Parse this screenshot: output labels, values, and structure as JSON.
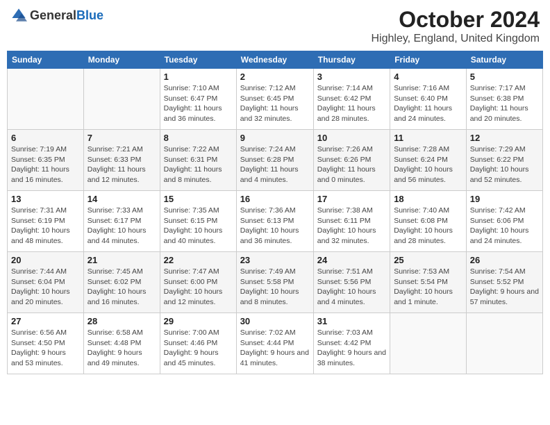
{
  "logo": {
    "text_general": "General",
    "text_blue": "Blue"
  },
  "header": {
    "month_title": "October 2024",
    "location": "Highley, England, United Kingdom"
  },
  "weekdays": [
    "Sunday",
    "Monday",
    "Tuesday",
    "Wednesday",
    "Thursday",
    "Friday",
    "Saturday"
  ],
  "weeks": [
    [
      {
        "day": "",
        "info": ""
      },
      {
        "day": "",
        "info": ""
      },
      {
        "day": "1",
        "info": "Sunrise: 7:10 AM\nSunset: 6:47 PM\nDaylight: 11 hours and 36 minutes."
      },
      {
        "day": "2",
        "info": "Sunrise: 7:12 AM\nSunset: 6:45 PM\nDaylight: 11 hours and 32 minutes."
      },
      {
        "day": "3",
        "info": "Sunrise: 7:14 AM\nSunset: 6:42 PM\nDaylight: 11 hours and 28 minutes."
      },
      {
        "day": "4",
        "info": "Sunrise: 7:16 AM\nSunset: 6:40 PM\nDaylight: 11 hours and 24 minutes."
      },
      {
        "day": "5",
        "info": "Sunrise: 7:17 AM\nSunset: 6:38 PM\nDaylight: 11 hours and 20 minutes."
      }
    ],
    [
      {
        "day": "6",
        "info": "Sunrise: 7:19 AM\nSunset: 6:35 PM\nDaylight: 11 hours and 16 minutes."
      },
      {
        "day": "7",
        "info": "Sunrise: 7:21 AM\nSunset: 6:33 PM\nDaylight: 11 hours and 12 minutes."
      },
      {
        "day": "8",
        "info": "Sunrise: 7:22 AM\nSunset: 6:31 PM\nDaylight: 11 hours and 8 minutes."
      },
      {
        "day": "9",
        "info": "Sunrise: 7:24 AM\nSunset: 6:28 PM\nDaylight: 11 hours and 4 minutes."
      },
      {
        "day": "10",
        "info": "Sunrise: 7:26 AM\nSunset: 6:26 PM\nDaylight: 11 hours and 0 minutes."
      },
      {
        "day": "11",
        "info": "Sunrise: 7:28 AM\nSunset: 6:24 PM\nDaylight: 10 hours and 56 minutes."
      },
      {
        "day": "12",
        "info": "Sunrise: 7:29 AM\nSunset: 6:22 PM\nDaylight: 10 hours and 52 minutes."
      }
    ],
    [
      {
        "day": "13",
        "info": "Sunrise: 7:31 AM\nSunset: 6:19 PM\nDaylight: 10 hours and 48 minutes."
      },
      {
        "day": "14",
        "info": "Sunrise: 7:33 AM\nSunset: 6:17 PM\nDaylight: 10 hours and 44 minutes."
      },
      {
        "day": "15",
        "info": "Sunrise: 7:35 AM\nSunset: 6:15 PM\nDaylight: 10 hours and 40 minutes."
      },
      {
        "day": "16",
        "info": "Sunrise: 7:36 AM\nSunset: 6:13 PM\nDaylight: 10 hours and 36 minutes."
      },
      {
        "day": "17",
        "info": "Sunrise: 7:38 AM\nSunset: 6:11 PM\nDaylight: 10 hours and 32 minutes."
      },
      {
        "day": "18",
        "info": "Sunrise: 7:40 AM\nSunset: 6:08 PM\nDaylight: 10 hours and 28 minutes."
      },
      {
        "day": "19",
        "info": "Sunrise: 7:42 AM\nSunset: 6:06 PM\nDaylight: 10 hours and 24 minutes."
      }
    ],
    [
      {
        "day": "20",
        "info": "Sunrise: 7:44 AM\nSunset: 6:04 PM\nDaylight: 10 hours and 20 minutes."
      },
      {
        "day": "21",
        "info": "Sunrise: 7:45 AM\nSunset: 6:02 PM\nDaylight: 10 hours and 16 minutes."
      },
      {
        "day": "22",
        "info": "Sunrise: 7:47 AM\nSunset: 6:00 PM\nDaylight: 10 hours and 12 minutes."
      },
      {
        "day": "23",
        "info": "Sunrise: 7:49 AM\nSunset: 5:58 PM\nDaylight: 10 hours and 8 minutes."
      },
      {
        "day": "24",
        "info": "Sunrise: 7:51 AM\nSunset: 5:56 PM\nDaylight: 10 hours and 4 minutes."
      },
      {
        "day": "25",
        "info": "Sunrise: 7:53 AM\nSunset: 5:54 PM\nDaylight: 10 hours and 1 minute."
      },
      {
        "day": "26",
        "info": "Sunrise: 7:54 AM\nSunset: 5:52 PM\nDaylight: 9 hours and 57 minutes."
      }
    ],
    [
      {
        "day": "27",
        "info": "Sunrise: 6:56 AM\nSunset: 4:50 PM\nDaylight: 9 hours and 53 minutes."
      },
      {
        "day": "28",
        "info": "Sunrise: 6:58 AM\nSunset: 4:48 PM\nDaylight: 9 hours and 49 minutes."
      },
      {
        "day": "29",
        "info": "Sunrise: 7:00 AM\nSunset: 4:46 PM\nDaylight: 9 hours and 45 minutes."
      },
      {
        "day": "30",
        "info": "Sunrise: 7:02 AM\nSunset: 4:44 PM\nDaylight: 9 hours and 41 minutes."
      },
      {
        "day": "31",
        "info": "Sunrise: 7:03 AM\nSunset: 4:42 PM\nDaylight: 9 hours and 38 minutes."
      },
      {
        "day": "",
        "info": ""
      },
      {
        "day": "",
        "info": ""
      }
    ]
  ]
}
